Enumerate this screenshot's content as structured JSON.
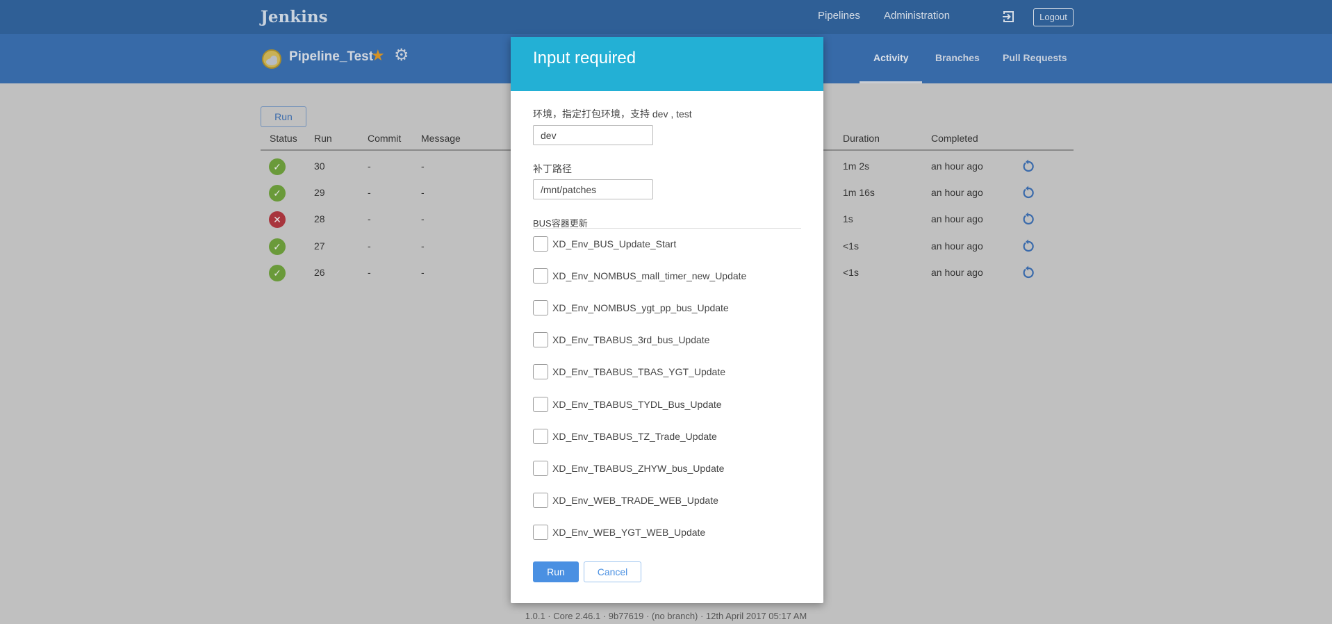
{
  "header": {
    "logo": "Jenkins",
    "nav": [
      "Pipelines",
      "Administration"
    ],
    "logout": "Logout"
  },
  "pipeline": {
    "name": "Pipeline_Test",
    "tabs": [
      "Activity",
      "Branches",
      "Pull Requests"
    ],
    "active_tab": "Activity"
  },
  "activity": {
    "run_button": "Run",
    "columns": [
      "Status",
      "Run",
      "Commit",
      "Message",
      "Duration",
      "Completed"
    ],
    "rows": [
      {
        "status": "success",
        "run": "30",
        "commit": "-",
        "message": "-",
        "duration": "1m 2s",
        "completed": "an hour ago"
      },
      {
        "status": "success",
        "run": "29",
        "commit": "-",
        "message": "-",
        "duration": "1m 16s",
        "completed": "an hour ago"
      },
      {
        "status": "failure",
        "run": "28",
        "commit": "-",
        "message": "-",
        "duration": "1s",
        "completed": "an hour ago"
      },
      {
        "status": "success",
        "run": "27",
        "commit": "-",
        "message": "-",
        "duration": "<1s",
        "completed": "an hour ago"
      },
      {
        "status": "success",
        "run": "26",
        "commit": "-",
        "message": "-",
        "duration": "<1s",
        "completed": "an hour ago"
      }
    ]
  },
  "colors": {
    "success": "#6a9a3a",
    "failure": "#a8353d",
    "accent": "#4a90e2",
    "modal_header": "#23b0d5"
  },
  "modal": {
    "title": "Input required",
    "env_label": "环境，指定打包环境，支持 dev , test",
    "env_value": "dev",
    "patch_label": "补丁路径",
    "patch_value": "/mnt/patches",
    "bus_label": "BUS容器更新",
    "options": [
      "XD_Env_BUS_Update_Start",
      "XD_Env_NOMBUS_mall_timer_new_Update",
      "XD_Env_NOMBUS_ygt_pp_bus_Update",
      "XD_Env_TBABUS_3rd_bus_Update",
      "XD_Env_TBABUS_TBAS_YGT_Update",
      "XD_Env_TBABUS_TYDL_Bus_Update",
      "XD_Env_TBABUS_TZ_Trade_Update",
      "XD_Env_TBABUS_ZHYW_bus_Update",
      "XD_Env_WEB_TRADE_WEB_Update",
      "XD_Env_WEB_YGT_WEB_Update"
    ],
    "run": "Run",
    "cancel": "Cancel"
  },
  "footer": "1.0.1 · Core 2.46.1 · 9b77619 · (no branch) · 12th April 2017 05:17 AM"
}
